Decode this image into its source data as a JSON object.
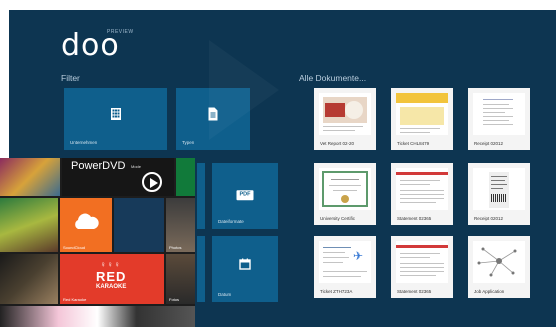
{
  "app": {
    "name": "doo",
    "badge": "PREVIEW"
  },
  "filter": {
    "title": "Filter",
    "tiles": [
      {
        "label": "Unternehmen",
        "icon": "building-icon"
      },
      {
        "label": "Typen",
        "icon": "document-icon"
      },
      {
        "label": "Dateiformate",
        "icon": "pdf-icon",
        "badge": "PDF"
      },
      {
        "label": "Datum",
        "icon": "calendar-icon"
      }
    ]
  },
  "documents": {
    "title": "Alle Dokumente...",
    "items": [
      {
        "label": "Vet Report 02-20"
      },
      {
        "label": "Ticket CHL8479"
      },
      {
        "label": "Receipt 02012"
      },
      {
        "label": "University Certific"
      },
      {
        "label": "Statement 02365"
      },
      {
        "label": "Receipt 02012"
      },
      {
        "label": "Ticket ZTH723A"
      },
      {
        "label": "Statement 02365"
      },
      {
        "label": "Job Application"
      }
    ]
  },
  "start_screen": {
    "powerdvd_title": "PowerDVD",
    "powerdvd_mode": "Mode",
    "tiles": [
      {
        "label": "SoundCloud"
      },
      {
        "label": "Red Karaoke"
      },
      {
        "label": "Photos"
      },
      {
        "label": "Fotos"
      }
    ],
    "red_karaoke_text_top": "RED",
    "red_karaoke_text_bottom": "KARAOKE"
  },
  "colors": {
    "background": "#0d3551",
    "tile": "#0f5f8c",
    "soundcloud": "#f26f22",
    "red": "#e33b2a",
    "green": "#117a3a"
  }
}
